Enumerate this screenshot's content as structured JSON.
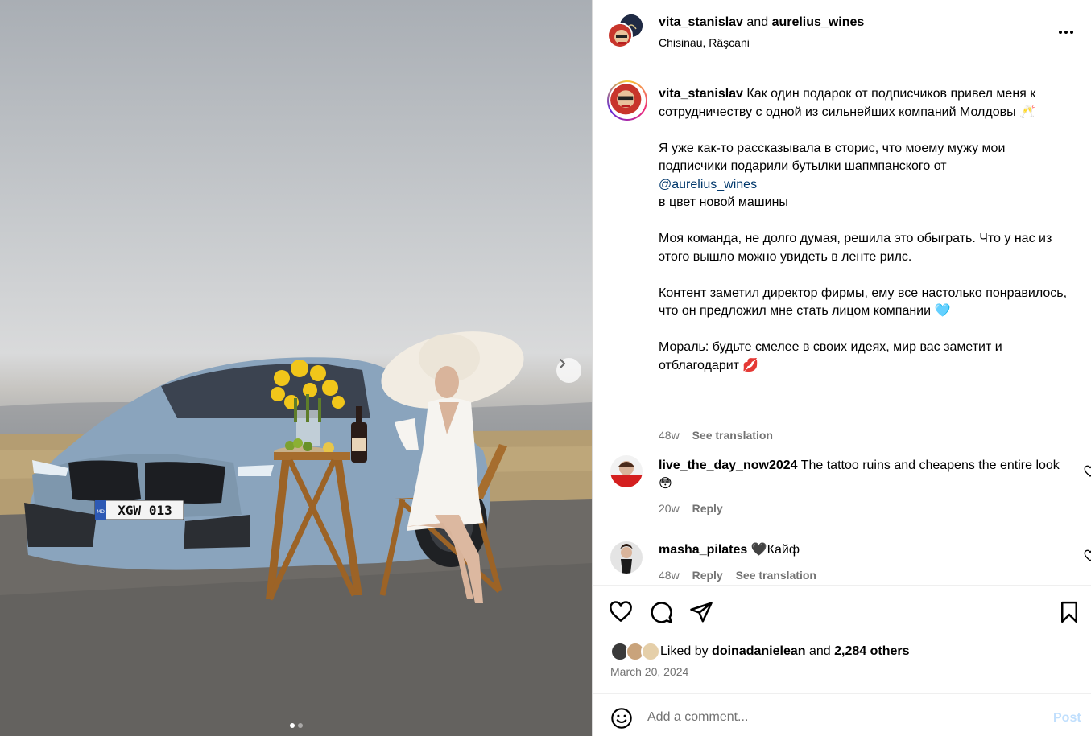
{
  "post": {
    "author": "vita_stanislav",
    "joiner": "and",
    "collaborator": "aurelius_wines",
    "location": "Chisinau, Râşcani",
    "media": {
      "plate_text": "XGW 013",
      "plate_country": "MD",
      "carousel_count": 2,
      "carousel_active": 1
    }
  },
  "caption": {
    "author": "vita_stanislav",
    "line1": "Как один подарок от подписчиков привел меня к сотрудничеству с одной из сильнейших компаний Молдовы 🥂",
    "para2": "Я уже как-то рассказывала в сторис, что моему мужу мои подписчики подарили бутылки шапмпанского от",
    "mention": "@aurelius_wines",
    "para2b": "в цвет новой машины",
    "para3": "Моя команда, не долго думая, решила это обыграть. Что у нас из этого вышло можно увидеть в ленте рилс.",
    "para4": "Контент заметил директор фирмы, ему все настолько понравилось, что он предложил мне стать лицом компании 🩵",
    "para5": "Мораль: будьте смелее в своих идеях, мир вас заметит и отблагодарит 💋",
    "time": "48w",
    "see_translation": "See translation"
  },
  "comments": [
    {
      "user": "live_the_day_now2024",
      "text": "The tattoo ruins and cheapens the entire look 😳",
      "time": "20w",
      "reply": "Reply"
    },
    {
      "user": "masha_pilates",
      "text": "🖤Кайф",
      "time": "48w",
      "reply": "Reply",
      "see_translation": "See translation"
    }
  ],
  "likes": {
    "prefix": "Liked by",
    "user": "doinadanielean",
    "and": "and",
    "others": "2,284 others",
    "date": "March 20, 2024"
  },
  "add_comment": {
    "placeholder": "Add a comment...",
    "post_label": "Post"
  },
  "colors": {
    "link": "#00376b",
    "secondary_text": "#737373",
    "post_disabled": "#c0dffd",
    "car": "#8aa4bd"
  }
}
